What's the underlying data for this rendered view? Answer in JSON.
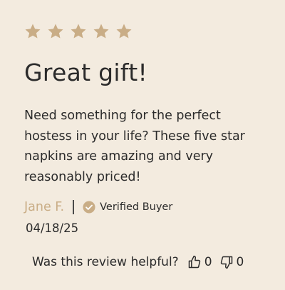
{
  "review": {
    "rating": 5,
    "rating_max": 5,
    "star_color": "#c9ad86",
    "title": "Great gift!",
    "body": "Need something for the perfect hostess in your life? These five star napkins are amazing and very reasonably priced!",
    "author": "Jane F.",
    "author_color": "#c9ad86",
    "verified_label": "Verified Buyer",
    "verified_icon": "check-circle-icon",
    "date": "04/18/25"
  },
  "helpful": {
    "question": "Was this review helpful?",
    "up_icon": "thumbs-up-icon",
    "up_count": "0",
    "down_icon": "thumbs-down-icon",
    "down_count": "0"
  },
  "colors": {
    "background": "#f3ebdf",
    "text": "#2b2b2b",
    "accent": "#c9ad86"
  }
}
